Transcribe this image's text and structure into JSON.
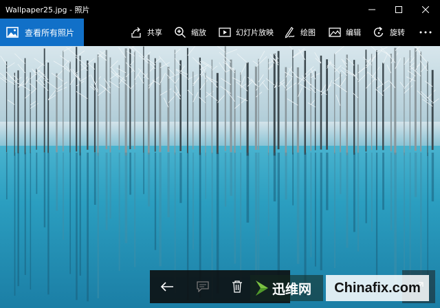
{
  "window": {
    "title": "Wallpaper25.jpg - 照片"
  },
  "commandbar": {
    "all_photos_label": "查看所有照片",
    "commands": [
      {
        "label": "共享",
        "icon": "share-icon"
      },
      {
        "label": "缩放",
        "icon": "zoom-icon"
      },
      {
        "label": "幻灯片放映",
        "icon": "slideshow-icon"
      },
      {
        "label": "绘图",
        "icon": "draw-icon"
      },
      {
        "label": "编辑",
        "icon": "edit-icon"
      },
      {
        "label": "旋转",
        "icon": "rotate-icon"
      }
    ],
    "more_icon": "more-icon"
  },
  "bottom_controls": {
    "icons": [
      "back-arrow-icon",
      "comment-icon",
      "delete-icon"
    ]
  },
  "watermark": {
    "cn_text": "迅维网",
    "en_text": "Chinafix.com"
  },
  "colors": {
    "accent": "#1170c8",
    "water": "#2b9ec0"
  }
}
